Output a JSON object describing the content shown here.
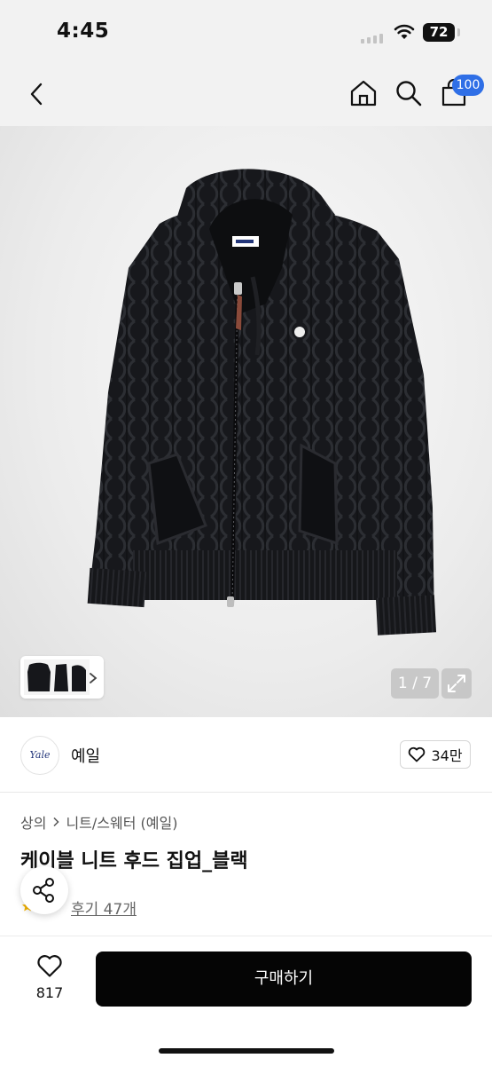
{
  "status_bar": {
    "time": "4:45",
    "battery": "72"
  },
  "nav": {
    "cart_badge": "100"
  },
  "gallery": {
    "counter": "1 / 7",
    "thumbnail_count": 3
  },
  "brand": {
    "logo_text": "Yale",
    "name": "예일",
    "likes": "34만"
  },
  "breadcrumb": {
    "level1": "상의",
    "level2": "니트/스웨터 (예일)"
  },
  "product": {
    "title": "케이블 니트 후드 집업_블랙",
    "reviews": "후기 47개"
  },
  "bottom": {
    "wish_count": "817",
    "buy_label": "구매하기"
  },
  "colors": {
    "badge_blue": "#2f6fe6",
    "buy_button": "#050505",
    "garment": "#16171b"
  },
  "icons": [
    "chevron-left-icon",
    "home-icon",
    "search-icon",
    "shopping-bag-icon",
    "chevron-right-icon",
    "expand-icon",
    "heart-icon",
    "share-icon"
  ]
}
